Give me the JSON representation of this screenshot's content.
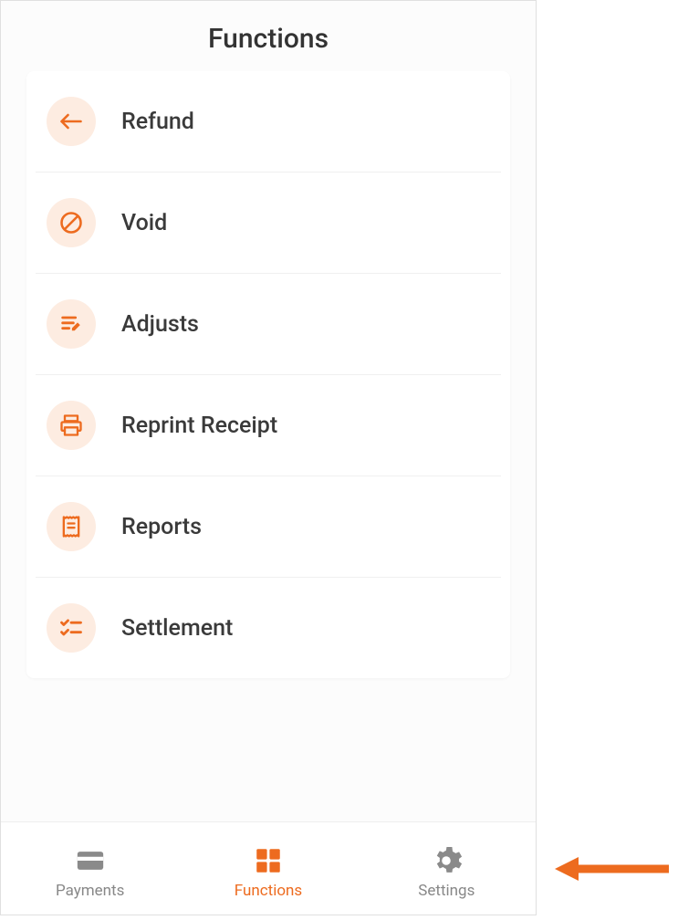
{
  "header": {
    "title": "Functions"
  },
  "items": [
    {
      "label": "Refund",
      "icon": "return-arrow-icon"
    },
    {
      "label": "Void",
      "icon": "prohibit-icon"
    },
    {
      "label": "Adjusts",
      "icon": "edit-lines-icon"
    },
    {
      "label": "Reprint Receipt",
      "icon": "printer-icon"
    },
    {
      "label": "Reports",
      "icon": "receipt-icon"
    },
    {
      "label": "Settlement",
      "icon": "checklist-icon"
    }
  ],
  "nav": {
    "payments": {
      "label": "Payments",
      "active": false
    },
    "functions": {
      "label": "Functions",
      "active": true
    },
    "settings": {
      "label": "Settings",
      "active": false
    }
  },
  "colors": {
    "accent": "#ed6b1f",
    "icon_bg": "#fdece1",
    "inactive": "#8a8a8a"
  }
}
